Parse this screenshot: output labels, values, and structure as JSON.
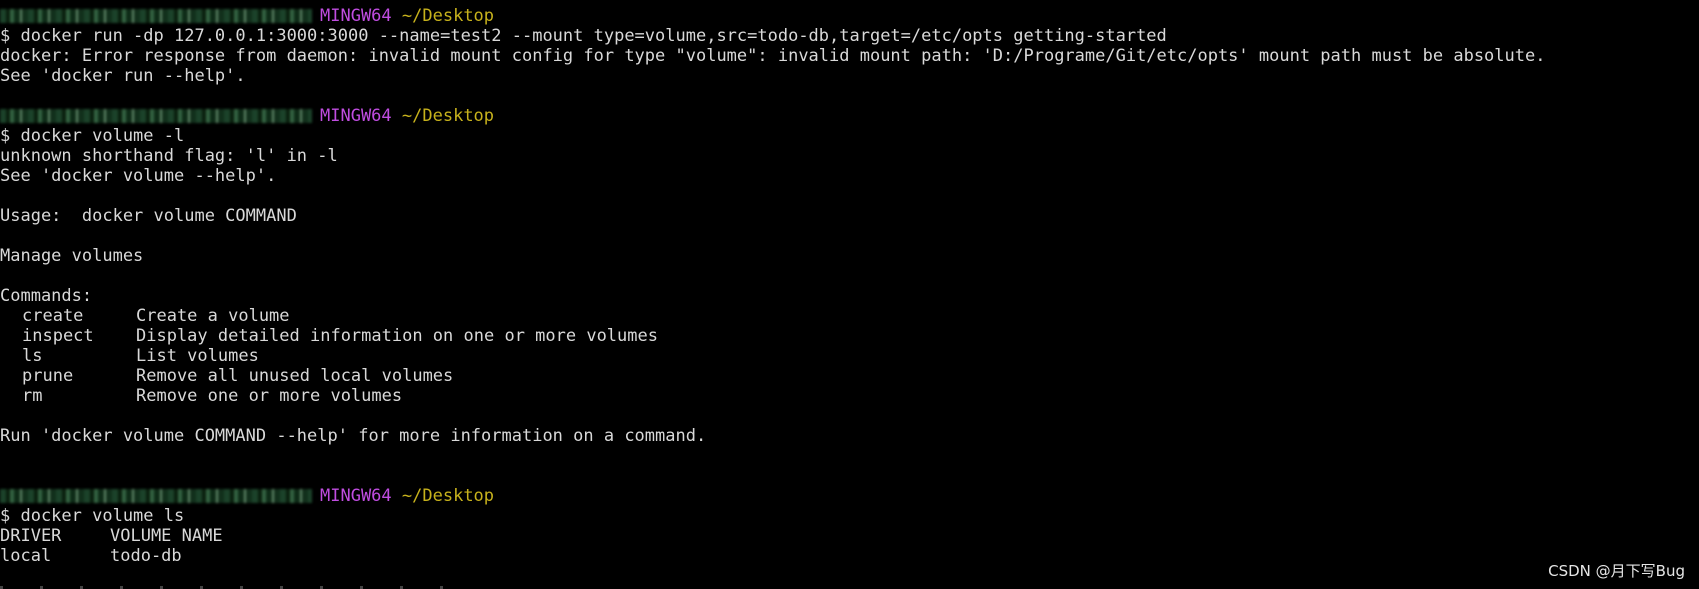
{
  "colors": {
    "background": "#000000",
    "text": "#d9d9d9",
    "host": "#c04de0",
    "path": "#c7b21c"
  },
  "prompt": {
    "host": "MINGW64",
    "path": "~/Desktop"
  },
  "block1": {
    "command": "$ docker run -dp 127.0.0.1:3000:3000 --name=test2 --mount type=volume,src=todo-db,target=/etc/opts getting-started",
    "error": "docker: Error response from daemon: invalid mount config for type \"volume\": invalid mount path: 'D:/Programe/Git/etc/opts' mount path must be absolute.",
    "hint": "See 'docker run --help'."
  },
  "block2": {
    "command": "$ docker volume -l",
    "error": "unknown shorthand flag: 'l' in -l",
    "hint": "See 'docker volume --help'.",
    "usage": "Usage:  docker volume COMMAND",
    "description": "Manage volumes",
    "commands_header": "Commands:",
    "commands": [
      {
        "name": "create",
        "desc": "Create a volume"
      },
      {
        "name": "inspect",
        "desc": "Display detailed information on one or more volumes"
      },
      {
        "name": "ls",
        "desc": "List volumes"
      },
      {
        "name": "prune",
        "desc": "Remove all unused local volumes"
      },
      {
        "name": "rm",
        "desc": "Remove one or more volumes"
      }
    ],
    "footer": "Run 'docker volume COMMAND --help' for more information on a command."
  },
  "block3": {
    "command": "$ docker volume ls",
    "table_headers": [
      "DRIVER",
      "VOLUME NAME"
    ],
    "rows": [
      {
        "driver": "local",
        "volume_name": "todo-db"
      }
    ]
  },
  "watermark": "CSDN @月下写Bug"
}
